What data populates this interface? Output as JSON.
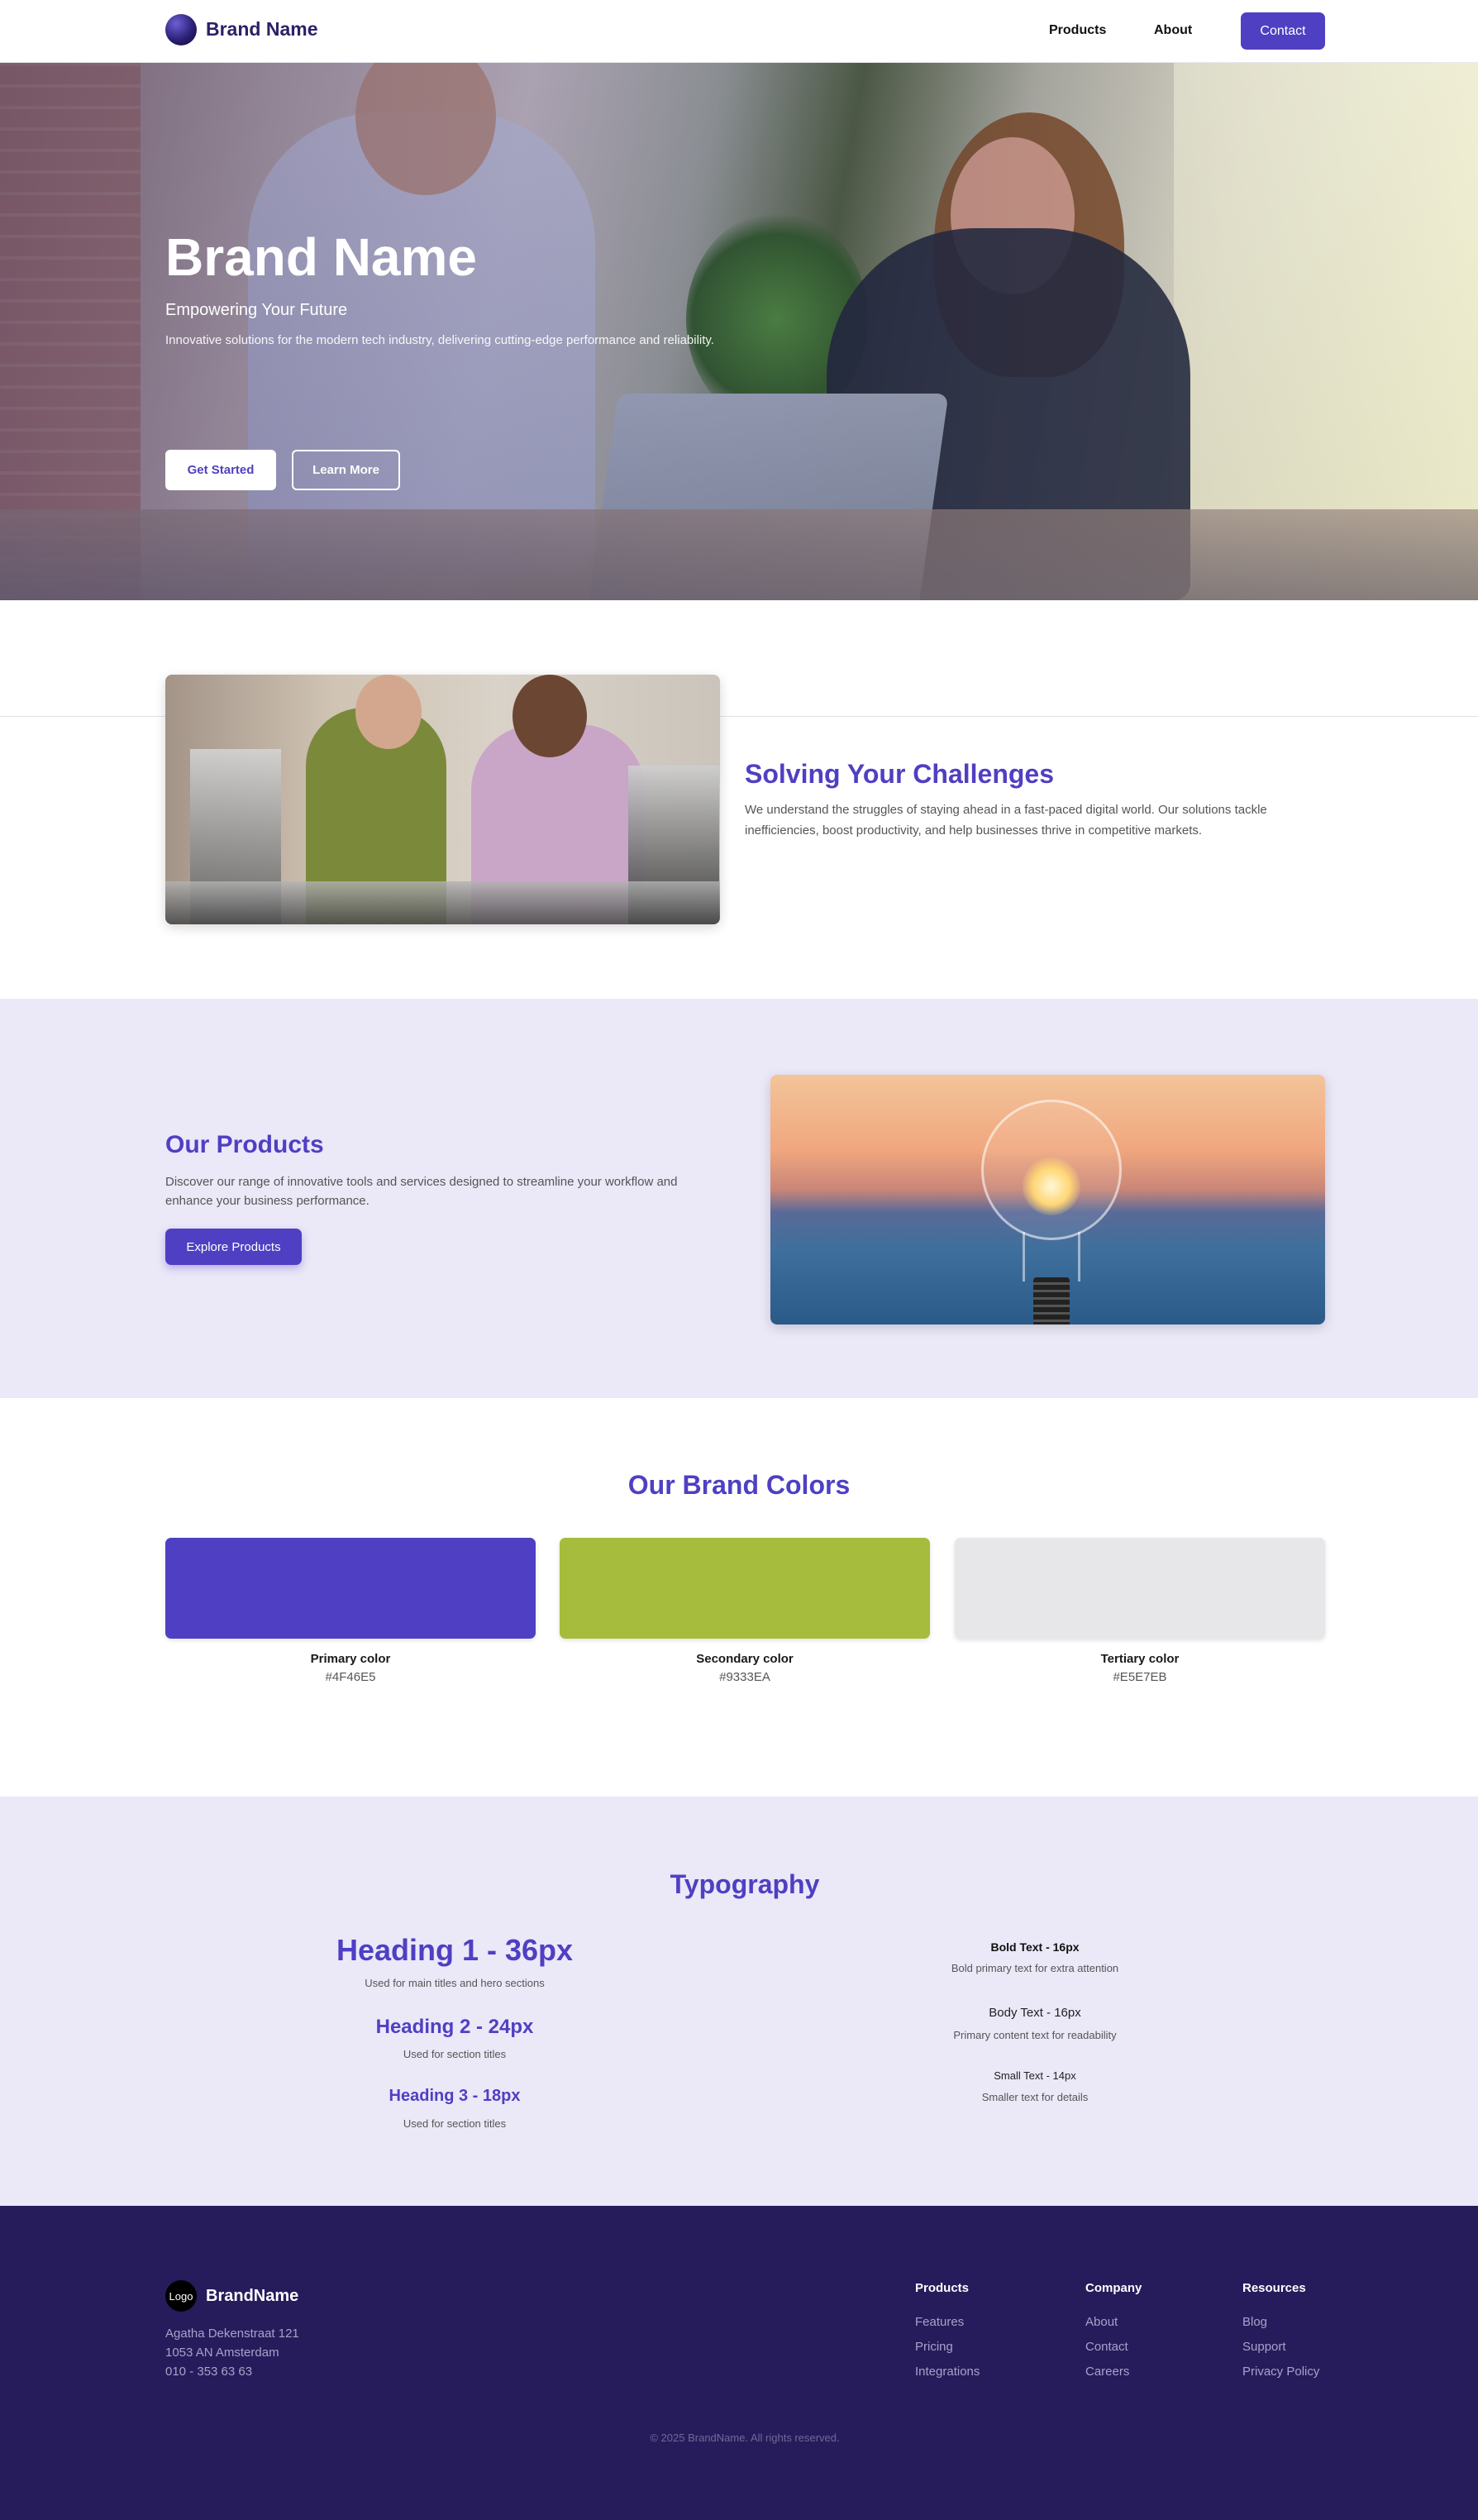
{
  "nav": {
    "brand": "Brand Name",
    "links": [
      "Products",
      "About"
    ],
    "contact": "Contact"
  },
  "hero": {
    "title": "Brand Name",
    "subtitle": "Empowering Your Future",
    "description": "Innovative solutions for the modern tech industry, delivering cutting-edge performance and reliability.",
    "primary_cta": "Get Started",
    "secondary_cta": "Learn More"
  },
  "challenges": {
    "title": "Solving Your Challenges",
    "text": "We understand the struggles of staying ahead in a fast-paced digital world. Our solutions tackle inefficiencies, boost productivity, and help businesses thrive in competitive markets."
  },
  "products": {
    "title": "Our Products",
    "text": "Discover our range of innovative tools and services designed to streamline your workflow and enhance your business performance.",
    "button": "Explore Products"
  },
  "brand_colors": {
    "title": "Our Brand Colors",
    "swatches": [
      {
        "name": "Primary color",
        "hex_label": "#4F46E5",
        "color": "#4f3fc3"
      },
      {
        "name": "Secondary color",
        "hex_label": "#9333EA",
        "color": "#a6bc3c"
      },
      {
        "name": "Tertiary color",
        "hex_label": "#E5E7EB",
        "color": "#e7e7ea"
      }
    ]
  },
  "typography": {
    "title": "Typography",
    "headings": [
      {
        "label": "Heading 1 - 36px",
        "note": "Used for main titles and hero sections"
      },
      {
        "label": "Heading 2 - 24px",
        "note": "Used for section titles"
      },
      {
        "label": "Heading 3 - 18px",
        "note": "Used for section titles"
      }
    ],
    "text_styles": [
      {
        "label": "Bold Text - 16px",
        "note": "Bold primary text for extra attention"
      },
      {
        "label": "Body Text - 16px",
        "note": "Primary content text for readability"
      },
      {
        "label": "Small Text - 14px",
        "note": "Smaller text for details"
      }
    ]
  },
  "footer": {
    "logo_text": "Logo",
    "brand": "BrandName",
    "address": [
      "Agatha Dekenstraat 121",
      "1053 AN Amsterdam",
      "010 - 353 63 63"
    ],
    "columns": [
      {
        "title": "Products",
        "links": [
          "Features",
          "Pricing",
          "Integrations"
        ]
      },
      {
        "title": "Company",
        "links": [
          "About",
          "Contact",
          "Careers"
        ]
      },
      {
        "title": "Resources",
        "links": [
          "Blog",
          "Support",
          "Privacy Policy"
        ]
      }
    ],
    "copyright": "© 2025 BrandName. All rights reserved."
  }
}
